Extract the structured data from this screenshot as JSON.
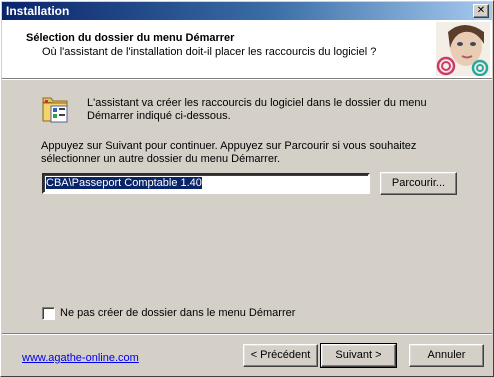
{
  "window": {
    "title": "Installation",
    "close_symbol": "✕"
  },
  "header": {
    "title": "Sélection du dossier du menu Démarrer",
    "subtitle": "Où l'assistant de l'installation doit-il placer les raccourcis du logiciel ?",
    "image_icon": "woman-face-logo-icon"
  },
  "body": {
    "icon": "start-menu-folder-icon",
    "description": "L'assistant va créer les raccourcis du logiciel dans le dossier du menu Démarrer indiqué ci-dessous.",
    "instruction": "Appuyez sur Suivant pour continuer. Appuyez sur Parcourir si vous souhaitez sélectionner un autre dossier du menu Démarrer.",
    "folder_value": "CBA\\Passeport Comptable 1.40",
    "browse_label": "Parcourir...",
    "no_folder_label": "Ne pas créer de dossier dans le menu Démarrer",
    "no_folder_checked": false
  },
  "footer": {
    "link": "www.agathe-online.com",
    "back_label": "< Précédent",
    "next_label": "Suivant >",
    "cancel_label": "Annuler"
  },
  "colors": {
    "titlebar_start": "#0a246a",
    "titlebar_end": "#a6caf0",
    "dialog_bg": "#d4d0c8",
    "link": "#0000ee"
  }
}
